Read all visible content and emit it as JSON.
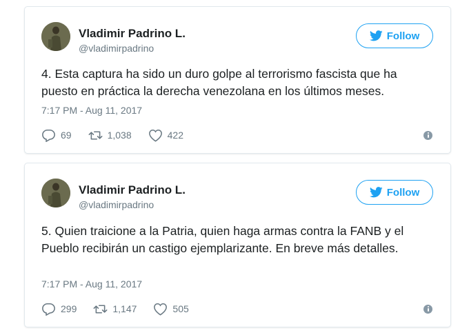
{
  "tweets": [
    {
      "author_name": "Vladimir Padrino L.",
      "author_handle": "@vladimirpadrino",
      "follow_label": "Follow",
      "text": "4. Esta captura ha sido un duro golpe al terrorismo fascista que ha puesto en práctica la derecha venezolana en los últimos meses.",
      "timestamp": "7:17 PM - Aug 11, 2017",
      "replies": "69",
      "retweets": "1,038",
      "likes": "422"
    },
    {
      "author_name": "Vladimir Padrino L.",
      "author_handle": "@vladimirpadrino",
      "follow_label": "Follow",
      "text": "5. Quien traicione a la Patria, quien haga armas contra la FANB y el Pueblo recibirán un castigo ejemplarizante. En breve más detalles.",
      "timestamp": "7:17 PM - Aug 11, 2017",
      "replies": "299",
      "retweets": "1,147",
      "likes": "505"
    }
  ],
  "colors": {
    "brand_blue": "#1da1f2",
    "muted_text": "#697882",
    "border": "#e1e8ed"
  },
  "icons": [
    "twitter-bird-icon",
    "reply-icon",
    "retweet-icon",
    "like-heart-icon",
    "info-icon"
  ]
}
